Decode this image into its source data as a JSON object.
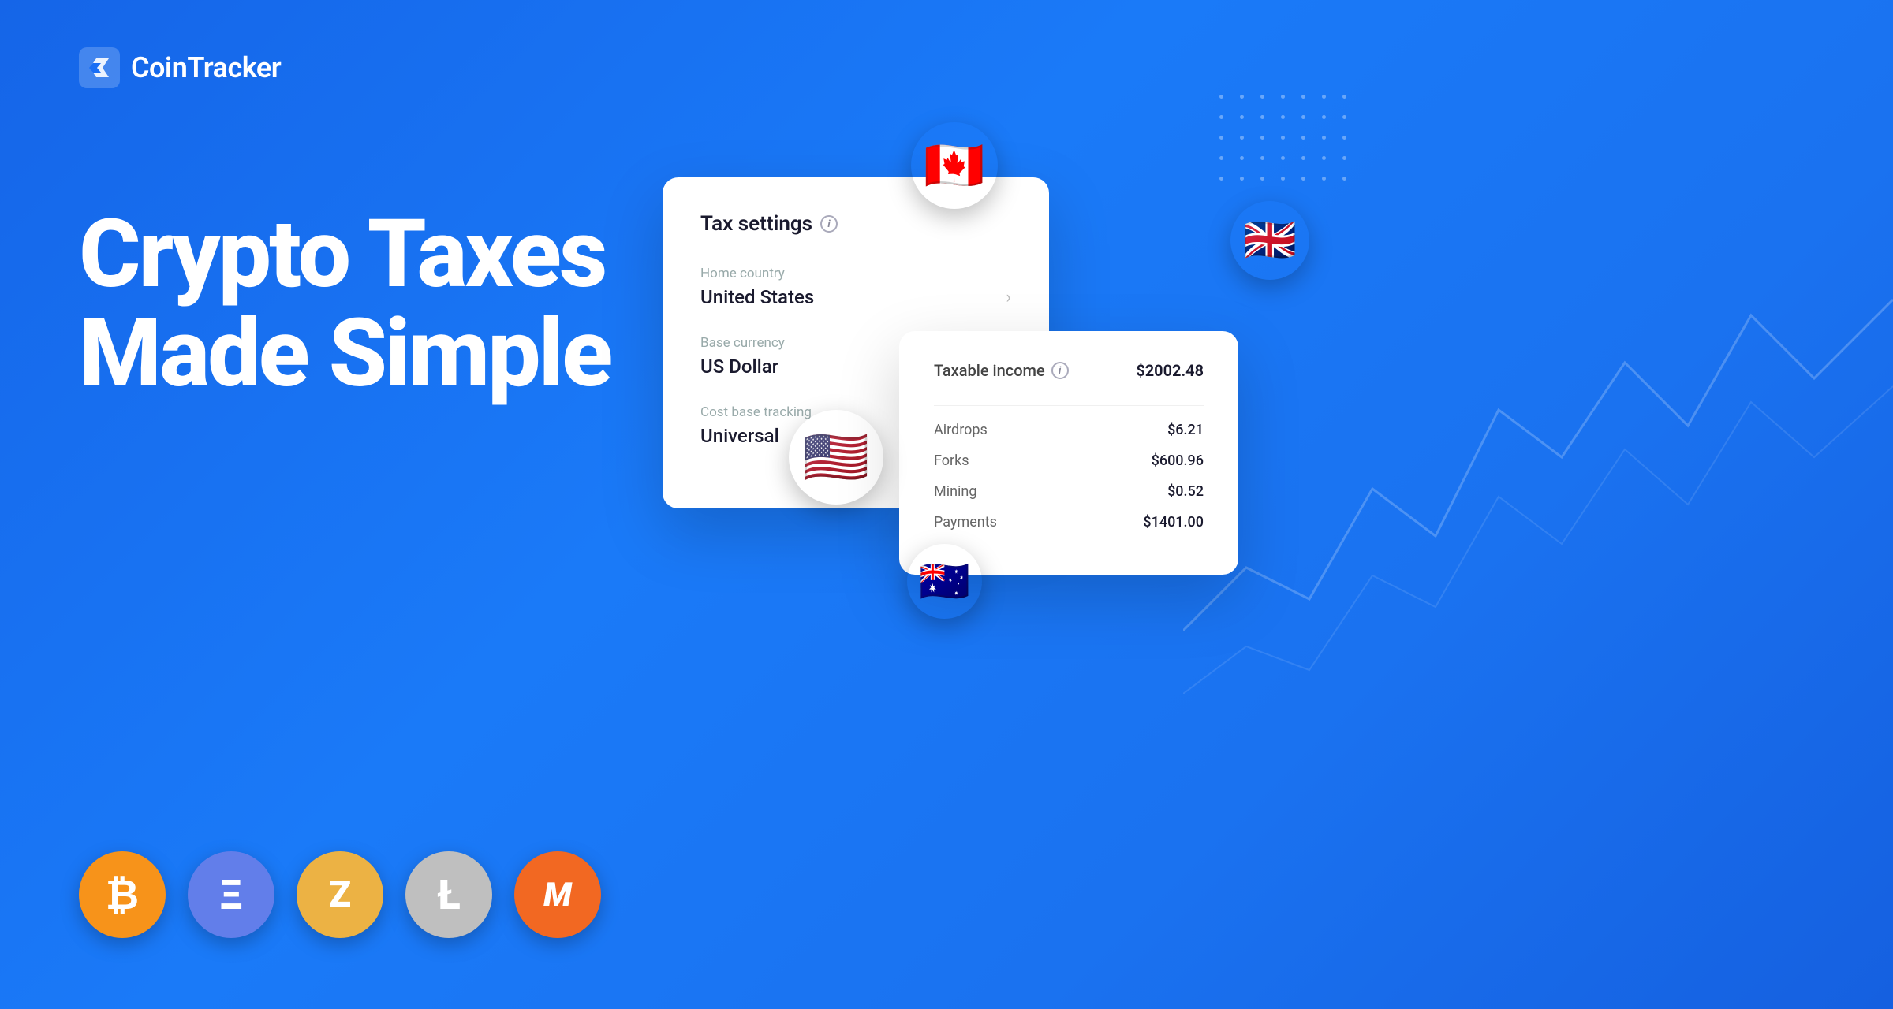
{
  "brand": {
    "name": "CoinTracker",
    "logo_alt": "CoinTracker logo"
  },
  "hero": {
    "line1": "Crypto Taxes",
    "line2": "Made Simple"
  },
  "tax_card": {
    "title": "Tax settings",
    "info_label": "i",
    "fields": [
      {
        "label": "Home country",
        "value": "United States",
        "has_chevron": true
      },
      {
        "label": "Base currency",
        "value": "US Dollar",
        "has_chevron": false
      },
      {
        "label": "Cost base tracking",
        "value": "Universal",
        "has_chevron": false
      }
    ]
  },
  "income_card": {
    "title": "Taxable income",
    "total": "$2002.48",
    "rows": [
      {
        "label": "Airdrops",
        "value": "$6.21"
      },
      {
        "label": "Forks",
        "value": "$600.96"
      },
      {
        "label": "Mining",
        "value": "$0.52"
      },
      {
        "label": "Payments",
        "value": "$1401.00"
      }
    ]
  },
  "flags": {
    "canada": "🇨🇦",
    "uk": "🇬🇧",
    "usa": "🇺🇸",
    "australia": "🇦🇺"
  },
  "crypto_coins": [
    {
      "symbol": "₿",
      "name": "Bitcoin",
      "class": "coin-btc"
    },
    {
      "symbol": "Ξ",
      "name": "Ethereum",
      "class": "coin-eth"
    },
    {
      "symbol": "Z",
      "name": "Zcash",
      "class": "coin-zec"
    },
    {
      "symbol": "Ł",
      "name": "Litecoin",
      "class": "coin-ltc"
    },
    {
      "symbol": "M",
      "name": "Monero",
      "class": "coin-xmr"
    }
  ]
}
